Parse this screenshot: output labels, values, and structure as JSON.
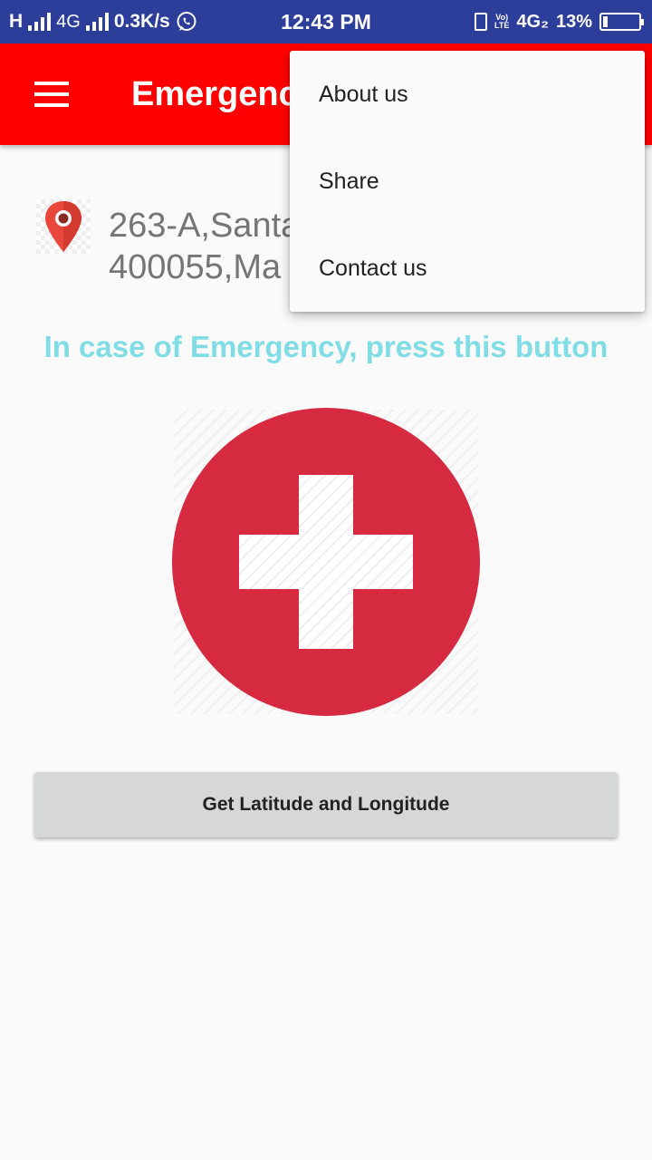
{
  "status_bar": {
    "network_left": "H",
    "network_type": "4G",
    "speed": "0.3K/s",
    "time": "12:43 PM",
    "volte_top": "Vo)",
    "volte_bottom": "LTE",
    "network_right": "4G₂",
    "battery_percent": "13%",
    "battery_level": 0.13,
    "icons": [
      "signal-icon",
      "whatsapp-icon",
      "vibrate-icon",
      "battery-icon"
    ]
  },
  "app_bar": {
    "title": "Emergency",
    "menu_icon": "hamburger-icon"
  },
  "address": {
    "icon": "location-pin-icon",
    "text": "263-A,Santa\n400055,Ma"
  },
  "emergency": {
    "prompt": "In case of Emergency, press this button",
    "button_icon": "medical-cross-icon",
    "button_color": "#d62a40"
  },
  "actions": {
    "latlng_label": "Get Latitude and Longitude"
  },
  "overflow_menu": {
    "items": [
      "About us",
      "Share",
      "Contact us"
    ]
  },
  "colors": {
    "status_bar": "#2d3e9a",
    "app_bar": "#ff0000",
    "prompt_text": "#80dde6",
    "button_bg": "#d6d7d7"
  }
}
